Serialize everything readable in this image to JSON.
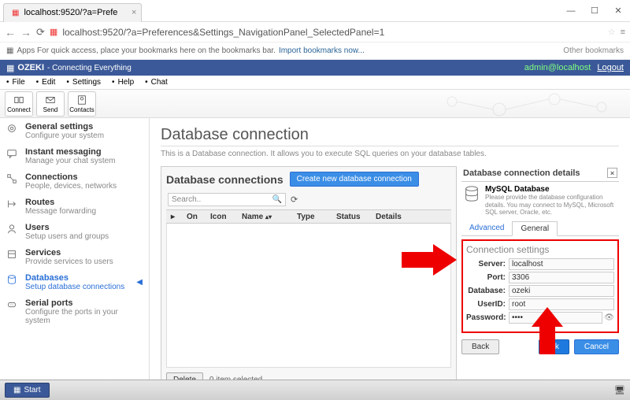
{
  "browser": {
    "tab_title": "localhost:9520/?a=Prefe",
    "url": "localhost:9520/?a=Preferences&Settings_NavigationPanel_SelectedPanel=1",
    "bookmark_hint_pre": "Apps   For quick access, place your bookmarks here on the bookmarks bar.",
    "bookmark_import": "Import bookmarks now...",
    "bookmark_other": "Other bookmarks"
  },
  "topbar": {
    "brand": "OZEKI",
    "tagline": "- Connecting Everything",
    "user": "admin@localhost",
    "logout": "Logout"
  },
  "menu": [
    "File",
    "Edit",
    "Settings",
    "Help",
    "Chat"
  ],
  "toolbar": {
    "connect": "Connect",
    "send": "Send",
    "contacts": "Contacts"
  },
  "sidebar": {
    "items": [
      {
        "title": "General settings",
        "sub": "Configure your system"
      },
      {
        "title": "Instant messaging",
        "sub": "Manage your chat system"
      },
      {
        "title": "Connections",
        "sub": "People, devices, networks"
      },
      {
        "title": "Routes",
        "sub": "Message forwarding"
      },
      {
        "title": "Users",
        "sub": "Setup users and groups"
      },
      {
        "title": "Services",
        "sub": "Provide services to users"
      },
      {
        "title": "Databases",
        "sub": "Setup database connections"
      },
      {
        "title": "Serial ports",
        "sub": "Configure the ports in your system"
      }
    ]
  },
  "page": {
    "title": "Database connection",
    "desc": "This is a Database connection. It allows you to execute SQL queries on your database tables."
  },
  "left_panel": {
    "title": "Database connections",
    "create_btn": "Create new database connection",
    "search_placeholder": "Search..",
    "columns": {
      "on": "On",
      "icon": "Icon",
      "name": "Name",
      "type": "Type",
      "status": "Status",
      "details": "Details"
    },
    "delete_btn": "Delete",
    "status": "0 item selected"
  },
  "right_panel": {
    "header": "Database connection details",
    "db_title": "MySQL Database",
    "db_desc": "Please provide the database configuration details. You may connect to MySQL, Microsoft SQL server, Oracle, etc.",
    "tabs": {
      "advanced": "Advanced",
      "general": "General"
    },
    "fieldset": "Connection settings",
    "labels": {
      "server": "Server:",
      "port": "Port:",
      "database": "Database:",
      "userid": "UserID:",
      "password": "Password:"
    },
    "values": {
      "server": "localhost",
      "port": "3306",
      "database": "ozeki",
      "userid": "root",
      "password": "••••"
    },
    "buttons": {
      "back": "Back",
      "ok": "Ok",
      "cancel": "Cancel"
    }
  },
  "start": "Start"
}
